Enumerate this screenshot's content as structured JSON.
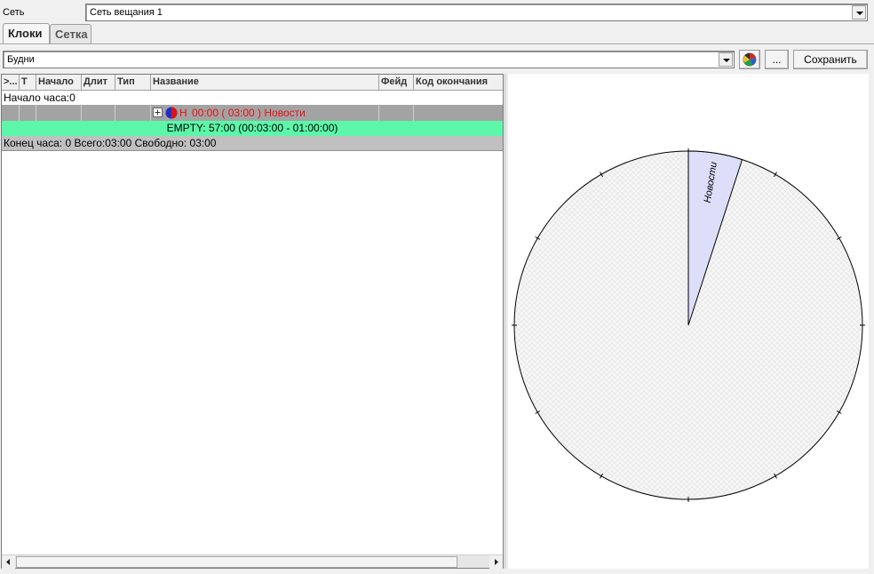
{
  "network": {
    "label": "Сеть",
    "value": "Сеть вещания 1"
  },
  "tabs": [
    {
      "label": "Клоки",
      "active": true
    },
    {
      "label": "Сетка",
      "active": false
    }
  ],
  "toolbar": {
    "template_value": "Будни",
    "more_label": "...",
    "save_label": "Сохранить"
  },
  "grid": {
    "columns": [
      ">...",
      "Т",
      "Начало",
      "Длит",
      "Тип",
      "Название",
      "Фейд",
      "Код окончания"
    ],
    "hour_start": "Начало часа:0",
    "block": {
      "prefix": "Н",
      "text": "00:00 ( 03:00 ) Новости",
      "color": "#e81010"
    },
    "empty_row": "EMPTY: 57:00 (00:03:00 - 01:00:00)",
    "hour_end": "Конец часа: 0 Всего:03:00 Свободно: 03:00",
    "colors": {
      "block_row": "#a3a3a3",
      "empty_row": "#5cf7a8",
      "end_row": "#c0c0c0"
    }
  },
  "clock": {
    "segments": [
      {
        "label": "Новости",
        "start_minutes": 0,
        "duration_minutes": 3,
        "color": "#dcdefa"
      }
    ],
    "total_minutes": 60
  }
}
